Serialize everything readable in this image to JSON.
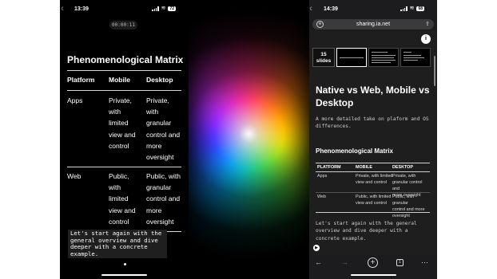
{
  "left_phone": {
    "status": {
      "time": "13:39",
      "battery": "72"
    },
    "timer": "00:00:11",
    "title": "Phenomenological Matrix",
    "table": {
      "headers": [
        "Platform",
        "Mobile",
        "Desktop"
      ],
      "rows": [
        {
          "platform": "Apps",
          "mobile": [
            "Private,",
            "with",
            "limited",
            "view and",
            "control"
          ],
          "desktop": [
            "Private,",
            "with",
            "granular",
            "control and",
            "more",
            "oversight"
          ]
        },
        {
          "platform": "Web",
          "mobile": [
            "Public,",
            "with",
            "limited",
            "view and",
            "control"
          ],
          "desktop": [
            "Public, with",
            "granular",
            "control and",
            "more",
            "oversight"
          ]
        }
      ]
    },
    "caption": [
      "Let's start again with the",
      "general overview and dive",
      "deeper with a concrete",
      "example."
    ]
  },
  "right_phone": {
    "status": {
      "time": "14:39",
      "battery": "68"
    },
    "url": "sharing.ia.net",
    "info_badge": "i",
    "slide_count": [
      "15",
      "slides"
    ],
    "title": "Native vs Web, Mobile vs Desktop",
    "subtitle": "A more detailed take on plaform and OS differences.",
    "section_title": "Phenomenological Matrix",
    "table": {
      "headers": [
        "PLATFORM",
        "MOBILE",
        "DESKTOP"
      ],
      "rows": [
        {
          "platform": "Apps",
          "mobile": [
            "Private, with limited",
            "view and control"
          ],
          "desktop": [
            "Private, with",
            "granular control and",
            "more oversight"
          ]
        },
        {
          "platform": "Web",
          "mobile": [
            "Public, with limited",
            "view and control"
          ],
          "desktop": [
            "Public, with granular",
            "control and more",
            "oversight"
          ]
        }
      ]
    },
    "caption": "Let's start again with the general overview and dive deeper with a concrete example.",
    "toolbar": {
      "tab_count": "1"
    }
  }
}
